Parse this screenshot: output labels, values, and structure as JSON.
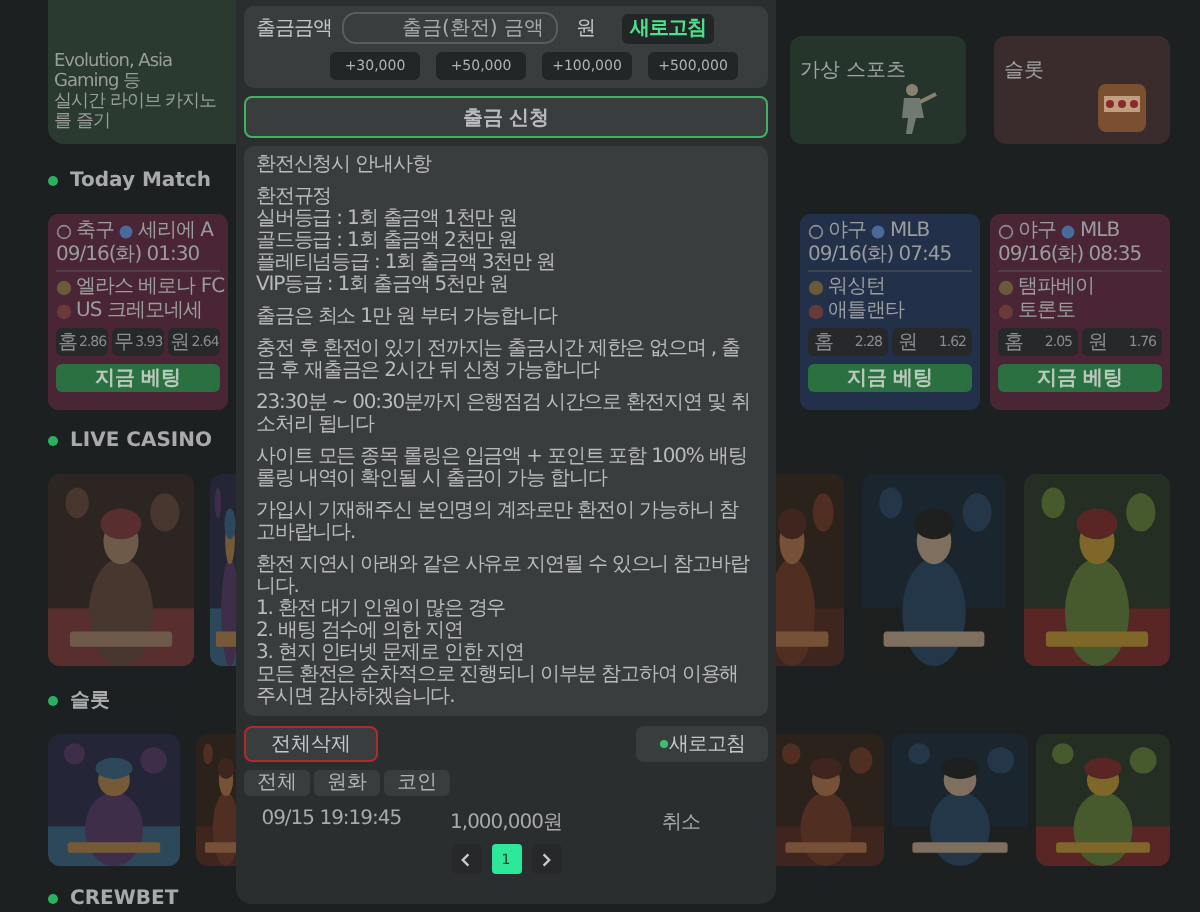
{
  "live_banner": {
    "lines": [
      "Evolution, Asia Gaming 등",
      "실시간 라이브 카지노를 즐기"
    ]
  },
  "category_cards": [
    {
      "title": "가상 스포츠"
    },
    {
      "title": "슬롯"
    }
  ],
  "today_match": {
    "heading": "Today Match",
    "matches": [
      {
        "sport": "축구",
        "league": "세리에 A",
        "time": "09/16(화) 01:30",
        "teams": [
          "엘라스 베로나 FC",
          "US 크레모네세"
        ],
        "odds": [
          {
            "label": "홈",
            "value": "2.86"
          },
          {
            "label": "무",
            "value": "3.93"
          },
          {
            "label": "원",
            "value": "2.64"
          }
        ],
        "bet": "지금 베팅",
        "color": "#4a2535"
      },
      {
        "sport": "야구",
        "league": "MLB",
        "time": "09/16(화) 07:45",
        "teams": [
          "워싱턴",
          "애틀랜타"
        ],
        "odds": [
          {
            "label": "홈",
            "value": "2.28"
          },
          {
            "label": "원",
            "value": "1.62"
          }
        ],
        "bet": "지금 베팅",
        "color": "#22304a"
      },
      {
        "sport": "야구",
        "league": "MLB",
        "time": "09/16(화) 08:35",
        "teams": [
          "탬파베이",
          "토론토"
        ],
        "odds": [
          {
            "label": "홈",
            "value": "2.05"
          },
          {
            "label": "원",
            "value": "1.76"
          }
        ],
        "bet": "지금 베팅",
        "color": "#4a2535"
      }
    ]
  },
  "live_casino": {
    "heading": "LIVE  CASINO"
  },
  "slots": {
    "heading": "슬롯"
  },
  "crewbet": {
    "heading": "CREWBET"
  },
  "withdraw": {
    "amount_field": {
      "label": "출금금액",
      "placeholder": "출금(환전) 금액",
      "unit": "원"
    },
    "refresh_button": "새로고침",
    "quick_amounts": [
      "+30,000",
      "+50,000",
      "+100,000",
      "+500,000"
    ],
    "submit_button": "출금 신청"
  },
  "notice": {
    "paragraphs": [
      [
        "환전신청시 안내사항"
      ],
      [
        "환전규정",
        "실버등급 : 1회 출금액 1천만 원",
        "골드등급 : 1회 출금액 2천만 원",
        "플레티넘등급 : 1회 출금액 3천만 원",
        "VIP등급 : 1회 출금액 5천만 원"
      ],
      [
        "출금은 최소 1만 원 부터 가능합니다"
      ],
      [
        "충전 후 환전이 있기 전까지는 출금시간 제한은 없으며 , 출금 후 재출금은 2시간 뒤 신청 가능합니다"
      ],
      [
        "23:30분 ~ 00:30분까지 은행점검 시간으로 환전지연 및 취소처리 됩니다"
      ],
      [
        "사이트 모든 종목 롤링은 입금액 + 포인트 포함 100% 배팅 롤링 내역이 확인될 시 출금이 가능 합니다"
      ],
      [
        "가입시 기재해주신 본인명의 계좌로만 환전이 가능하니 참고바랍니다."
      ],
      [
        "환전 지연시 아래와 같은 사유로 지연될 수 있으니 참고바랍니다.",
        "1. 환전 대기 인원이 많은 경우",
        "2. 배팅 검수에 의한 지연",
        "3. 현지 인터넷 문제로 인한 지연",
        "모든 환전은 순차적으로 진행되니 이부분 참고하여 이용해주시면 감사하겠습니다."
      ]
    ]
  },
  "actions": {
    "delete_all": "전체삭제",
    "refresh": "새로고침"
  },
  "filters": [
    "전체",
    "원화",
    "코인"
  ],
  "records": [
    {
      "time": "09/15 19:19:45",
      "amount": "1,000,000원",
      "status": "취소"
    }
  ],
  "pagination": {
    "pages": [
      {
        "label": "1",
        "selected": true
      }
    ]
  }
}
